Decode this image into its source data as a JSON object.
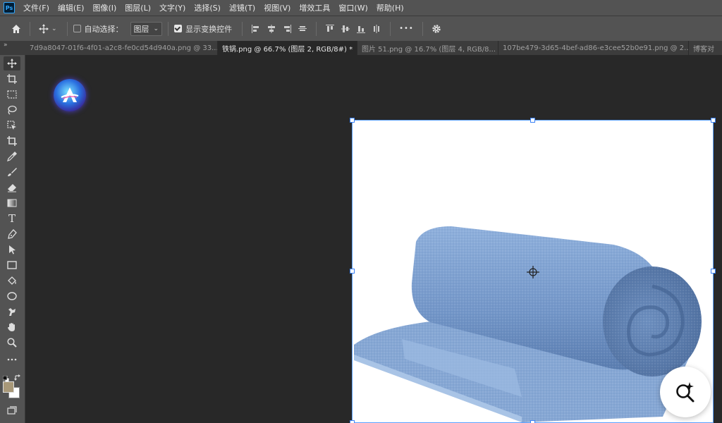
{
  "menu": [
    "文件(F)",
    "编辑(E)",
    "图像(I)",
    "图层(L)",
    "文字(Y)",
    "选择(S)",
    "滤镜(T)",
    "视图(V)",
    "增效工具",
    "窗口(W)",
    "帮助(H)"
  ],
  "app_logo": "Ps",
  "options": {
    "auto_select_label": "自动选择：",
    "auto_select_checked": false,
    "layer_dropdown_value": "图层",
    "show_transform_label": "显示变换控件",
    "show_transform_checked": true,
    "more_label": "•••"
  },
  "tabs": [
    {
      "label": "7d9a8047-01f6-4f01-a2c8-fe0cd54d940a.png @ 33...",
      "active": false,
      "close": "×"
    },
    {
      "label": "铁锅.png @ 66.7% (图层 2, RGB/8#) *",
      "active": true,
      "close": "×"
    },
    {
      "label": "图片 51.png @ 16.7% (图层 4, RGB/8...",
      "active": false,
      "close": "×"
    },
    {
      "label": "107be479-3d65-4bef-ad86-e3cee52b0e91.png @ 2...",
      "active": false,
      "close": "×"
    },
    {
      "label": "博客对",
      "active": false,
      "close": ""
    }
  ],
  "collapse_label": "»",
  "tools": [
    {
      "name": "move-tool",
      "icon": "move-icon",
      "active": true
    },
    {
      "name": "artboard-tool",
      "icon": "artboard-icon"
    },
    {
      "name": "marquee-tool",
      "icon": "marquee-icon"
    },
    {
      "name": "lasso-tool",
      "icon": "lasso-icon"
    },
    {
      "name": "object-select-tool",
      "icon": "object-select-icon"
    },
    {
      "name": "crop-tool",
      "icon": "crop-icon"
    },
    {
      "name": "eyedropper-tool",
      "icon": "eyedropper-icon"
    },
    {
      "name": "brush-tool",
      "icon": "brush-icon"
    },
    {
      "name": "eraser-tool",
      "icon": "eraser-icon"
    },
    {
      "name": "gradient-tool",
      "icon": "gradient-icon"
    },
    {
      "name": "type-tool",
      "icon": "type-icon"
    },
    {
      "name": "pen-tool",
      "icon": "pen-icon"
    },
    {
      "name": "path-select-tool",
      "icon": "path-select-icon"
    },
    {
      "name": "rectangle-tool",
      "icon": "rectangle-icon"
    },
    {
      "name": "paint-bucket-tool",
      "icon": "paint-bucket-icon"
    },
    {
      "name": "ellipse-tool",
      "icon": "ellipse-icon"
    },
    {
      "name": "puppet-tool",
      "icon": "puppet-icon"
    },
    {
      "name": "hand-tool",
      "icon": "hand-icon"
    },
    {
      "name": "zoom-tool",
      "icon": "zoom-icon"
    },
    {
      "name": "more-tools",
      "icon": "more-icon"
    }
  ],
  "colors": {
    "foreground": "#a89878",
    "background": "#ffffff",
    "towel": "#7b9fce",
    "accent": "#3b82f6"
  },
  "type_tool_glyph": "T"
}
